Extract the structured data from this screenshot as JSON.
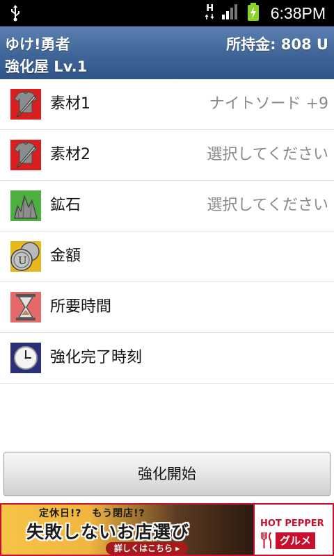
{
  "status_bar": {
    "network_label": "H",
    "time": "6:38PM"
  },
  "header": {
    "app_title": "ゆけ!勇者",
    "money": "所持金: 808 U",
    "shop": "強化屋 Lv.1"
  },
  "list": {
    "items": [
      {
        "label": "素材1",
        "value": "ナイトソード +9",
        "icon": "armor-sword-icon"
      },
      {
        "label": "素材2",
        "value": "選択してください",
        "icon": "armor-sword-icon"
      },
      {
        "label": "鉱石",
        "value": "選択してください",
        "icon": "ore-crystal-icon"
      },
      {
        "label": "金額",
        "value": "",
        "icon": "coins-icon"
      },
      {
        "label": "所要時間",
        "value": "",
        "icon": "hourglass-icon"
      },
      {
        "label": "強化完了時刻",
        "value": "",
        "icon": "clock-icon"
      }
    ]
  },
  "start_button": {
    "label": "強化開始"
  },
  "ad": {
    "top_text": "定休日!?　もう閉店!?",
    "main_text": "失敗しないお店選び",
    "link_text": "詳しくはこちら",
    "brand": "HOT PEPPER",
    "brand_sub": "グルメ"
  },
  "colors": {
    "header": "#3f6598",
    "status_bar": "#000000",
    "ad_red": "#c8102e",
    "value_gray": "#8a8a8a"
  }
}
